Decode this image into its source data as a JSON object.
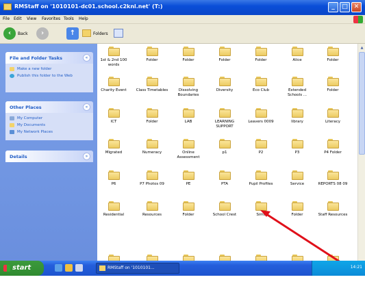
{
  "window": {
    "title": "RMStaff on '1010101-dc01.school.c2knl.net' (T:)",
    "minimize": "_",
    "maximize": "□",
    "close": "✕"
  },
  "menu": [
    "File",
    "Edit",
    "View",
    "Favorites",
    "Tools",
    "Help"
  ],
  "toolbar": {
    "back": "Back",
    "folders": "Folders"
  },
  "sidebar": {
    "file_tasks": {
      "title": "File and Folder Tasks",
      "items": [
        "Make a new folder",
        "Publish this folder to the Web"
      ]
    },
    "other_places": {
      "title": "Other Places",
      "items": [
        "My Computer",
        "My Documents",
        "My Network Places"
      ]
    },
    "details": {
      "title": "Details"
    }
  },
  "folders": [
    "1st & 2nd 100 words",
    "Folder",
    "Folder",
    "Folder",
    "Folder",
    "Alice",
    "Folder",
    "Charity Event",
    "Class Timetables",
    "Dissolving Boundaries",
    "Diversity",
    "Eco Club",
    "Extended Schools ...",
    "Folder",
    "ICT",
    "Folder",
    "LAB",
    "LEARNING SUPPORT",
    "Leavers 0009",
    "library",
    "Literacy",
    "Migrated",
    "Numeracy",
    "Online Assessment",
    "p1",
    "P2",
    "P3",
    "P4 Folder",
    "P6",
    "P7 Photos 09",
    "PE",
    "PTA",
    "Pupil Profiles",
    "Service",
    "REPORTS 08 09",
    "Residential",
    "Resources",
    "Folder",
    "School Crest",
    "Sims",
    "Folder",
    "Staff Resources"
  ],
  "taskbar": {
    "start": "start",
    "task": "RMStaff on '1010101...",
    "time": "14:21"
  },
  "colors": {
    "title_blue": "#0a4ed8",
    "sidebar_blue": "#7ba0e8",
    "annotation_red": "#e0101a"
  }
}
